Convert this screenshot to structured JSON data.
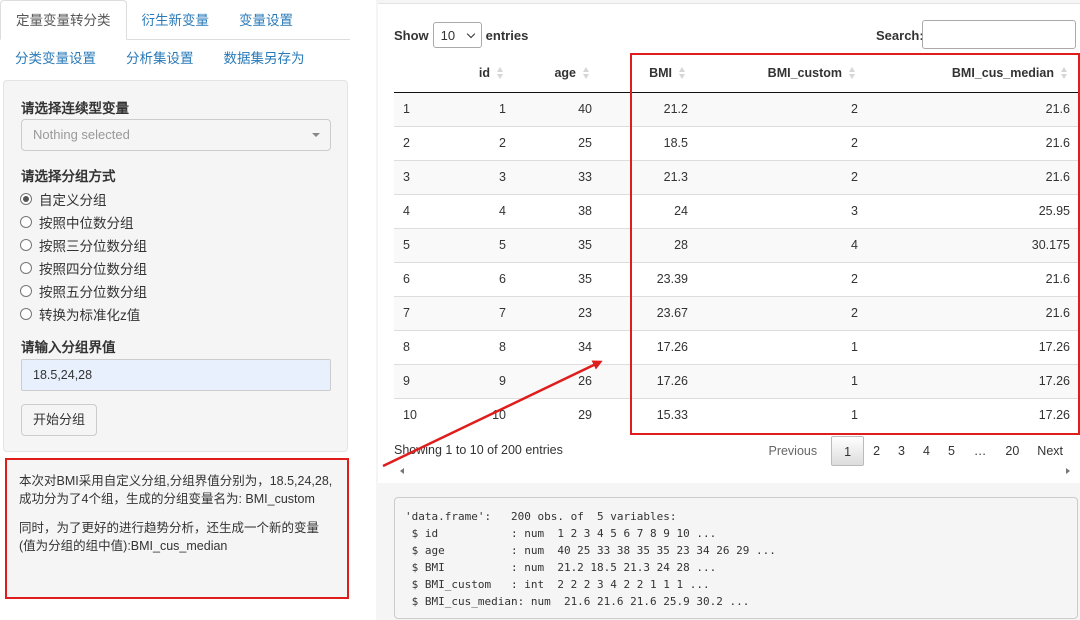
{
  "tabs_row1": [
    {
      "label": "定量变量转分类",
      "active": true
    },
    {
      "label": "衍生新变量",
      "active": false
    },
    {
      "label": "变量设置",
      "active": false
    }
  ],
  "tabs_row2": [
    {
      "label": "分类变量设置"
    },
    {
      "label": "分析集设置"
    },
    {
      "label": "数据集另存为"
    }
  ],
  "form": {
    "var_label": "请选择连续型变量",
    "var_placeholder": "Nothing selected",
    "method_label": "请选择分组方式",
    "methods": [
      "自定义分组",
      "按照中位数分组",
      "按照三分位数分组",
      "按照四分位数分组",
      "按照五分位数分组",
      "转换为标准化z值"
    ],
    "selected_method_index": 0,
    "cut_label": "请输入分组界值",
    "cut_value": "18.5,24,28",
    "submit_label": "开始分组"
  },
  "message": {
    "line1": "本次对BMI采用自定义分组,分组界值分别为，18.5,24,28, 成功分为了4个组，生成的分组变量名为: BMI_custom",
    "line2": "同时，为了更好的进行趋势分析，还生成一个新的变量(值为分组的组中值):BMI_cus_median"
  },
  "table_controls": {
    "show": "Show",
    "length": "10",
    "entries": "entries",
    "search_label": "Search:"
  },
  "table": {
    "columns": [
      "",
      "id",
      "age",
      "BMI",
      "BMI_custom",
      "BMI_cus_median"
    ],
    "rows": [
      [
        "1",
        "1",
        "40",
        "21.2",
        "2",
        "21.6"
      ],
      [
        "2",
        "2",
        "25",
        "18.5",
        "2",
        "21.6"
      ],
      [
        "3",
        "3",
        "33",
        "21.3",
        "2",
        "21.6"
      ],
      [
        "4",
        "4",
        "38",
        "24",
        "3",
        "25.95"
      ],
      [
        "5",
        "5",
        "35",
        "28",
        "4",
        "30.175"
      ],
      [
        "6",
        "6",
        "35",
        "23.39",
        "2",
        "21.6"
      ],
      [
        "7",
        "7",
        "23",
        "23.67",
        "2",
        "21.6"
      ],
      [
        "8",
        "8",
        "34",
        "17.26",
        "1",
        "17.26"
      ],
      [
        "9",
        "9",
        "26",
        "17.26",
        "1",
        "17.26"
      ],
      [
        "10",
        "10",
        "29",
        "15.33",
        "1",
        "17.26"
      ]
    ]
  },
  "table_info": "Showing 1 to 10 of 200 entries",
  "pagination": {
    "previous": "Previous",
    "pages": [
      "1",
      "2",
      "3",
      "4",
      "5",
      "…",
      "20"
    ],
    "current": "1",
    "next": "Next"
  },
  "str_output": "'data.frame':\t200 obs. of  5 variables:\n $ id           : num  1 2 3 4 5 6 7 8 9 10 ...\n $ age          : num  40 25 33 38 35 35 23 34 26 29 ...\n $ BMI          : num  21.2 18.5 21.3 24 28 ...\n $ BMI_custom   : int  2 2 2 3 4 2 2 1 1 1 ...\n $ BMI_cus_median: num  21.6 21.6 21.6 25.9 30.2 ...",
  "colors": {
    "tab_link": "#2a7ab8",
    "annotation_red": "#e01d1d",
    "well_bg": "#f5f5f5"
  }
}
